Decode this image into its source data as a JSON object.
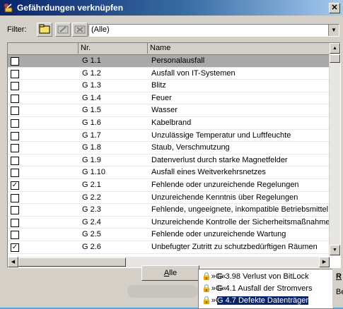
{
  "window": {
    "title": "Gefährdungen verknüpfen",
    "close_glyph": "✕"
  },
  "filter": {
    "label": "Filter:",
    "selected": "(Alle)",
    "buttons": [
      "folder-new-icon",
      "folder-edit-icon",
      "folder-delete-icon"
    ]
  },
  "grid": {
    "columns": [
      "",
      "Nr.",
      "Name"
    ],
    "rows": [
      {
        "checked": false,
        "nr": "G 1.1",
        "name": "Personalausfall",
        "selected": true
      },
      {
        "checked": false,
        "nr": "G 1.2",
        "name": "Ausfall von IT-Systemen"
      },
      {
        "checked": false,
        "nr": "G 1.3",
        "name": "Blitz"
      },
      {
        "checked": false,
        "nr": "G 1.4",
        "name": "Feuer"
      },
      {
        "checked": false,
        "nr": "G 1.5",
        "name": "Wasser"
      },
      {
        "checked": false,
        "nr": "G 1.6",
        "name": "Kabelbrand"
      },
      {
        "checked": false,
        "nr": "G 1.7",
        "name": "Unzulässige Temperatur und Luftfeuchte"
      },
      {
        "checked": false,
        "nr": "G 1.8",
        "name": "Staub, Verschmutzung"
      },
      {
        "checked": false,
        "nr": "G 1.9",
        "name": "Datenverlust durch starke Magnetfelder"
      },
      {
        "checked": false,
        "nr": "G 1.10",
        "name": "Ausfall eines Weitverkehrsnetzes"
      },
      {
        "checked": true,
        "nr": "G 2.1",
        "name": "Fehlende oder unzureichende Regelungen"
      },
      {
        "checked": false,
        "nr": "G 2.2",
        "name": "Unzureichende Kenntnis über Regelungen"
      },
      {
        "checked": false,
        "nr": "G 2.3",
        "name": "Fehlende, ungeeignete, inkompatible Betriebsmittel"
      },
      {
        "checked": false,
        "nr": "G 2.4",
        "name": "Unzureichende Kontrolle der Sicherheitsmaßnahmen"
      },
      {
        "checked": false,
        "nr": "G 2.5",
        "name": "Fehlende oder unzureichende Wartung"
      },
      {
        "checked": true,
        "nr": "G 2.6",
        "name": "Unbefugter Zutritt zu schutzbedürftigen Räumen"
      }
    ]
  },
  "buttons": {
    "alle_prefix": "A",
    "alle_rest": "lle"
  },
  "popup": {
    "items": [
      {
        "prefix": "»G«",
        "text": "G 3.98 Verlust von BitLock",
        "selected": false
      },
      {
        "prefix": "»G«",
        "text": "G 4.1 Ausfall der Stromvers",
        "selected": false
      },
      {
        "prefix": "»G«",
        "text": "G 4.7 Defekte Datenträger",
        "selected": true
      }
    ]
  },
  "right_panel": {
    "heading": "R",
    "text": "Be"
  },
  "colors": {
    "title_gradient_start": "#0a246a",
    "selection": "#0a246a",
    "row_highlight": "#a9a9a9",
    "face": "#d4d0c8"
  }
}
